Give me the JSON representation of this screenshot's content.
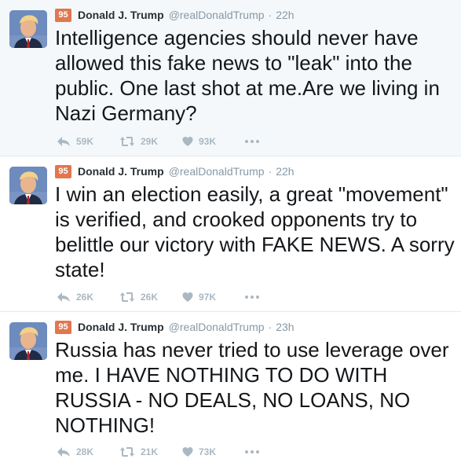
{
  "author": {
    "name": "Donald J. Trump",
    "handle": "@realDonaldTrump",
    "rank_badge": "95"
  },
  "tweets": [
    {
      "time": "22h",
      "text": "Intelligence agencies should never have allowed this fake news to \"leak\" into the public. One last shot at me.Are we living in Nazi Germany?",
      "replies": "59K",
      "retweets": "29K",
      "likes": "93K"
    },
    {
      "time": "22h",
      "text": "I win an election easily, a great \"movement\" is verified, and crooked opponents try to belittle our victory with FAKE NEWS. A sorry state!",
      "replies": "26K",
      "retweets": "26K",
      "likes": "97K"
    },
    {
      "time": "23h",
      "text": "Russia has never tried to use leverage over me. I HAVE NOTHING TO DO WITH RUSSIA - NO DEALS, NO LOANS, NO NOTHING!",
      "replies": "28K",
      "retweets": "21K",
      "likes": "73K"
    }
  ],
  "colors": {
    "badge": "#e2764f",
    "first_tweet_bg": "#f5f8fa",
    "action_icon": "#aab8c2",
    "meta_text": "#8899a6"
  }
}
